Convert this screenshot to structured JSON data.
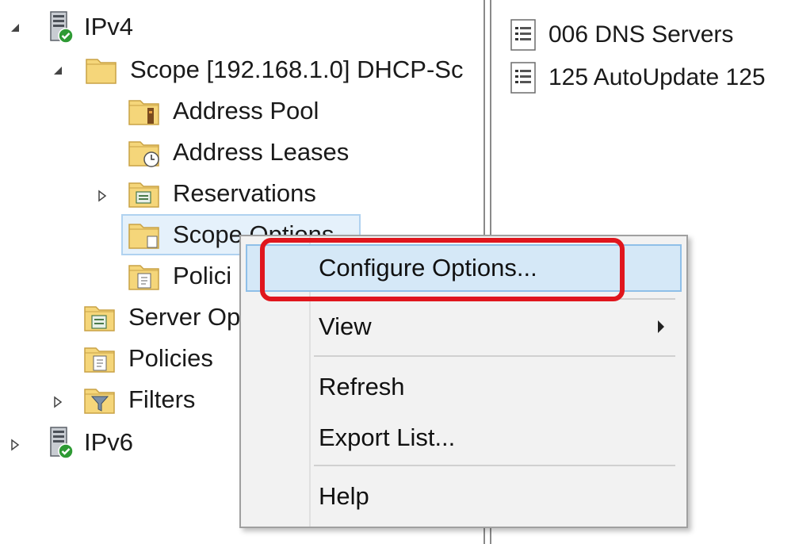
{
  "tree": {
    "ipv4": "IPv4",
    "scope": "Scope [192.168.1.0] DHCP-Sc",
    "address_pool": "Address Pool",
    "address_leases": "Address Leases",
    "reservations": "Reservations",
    "scope_options": "Scope Options",
    "scope_policies": "Polici",
    "server_options": "Server Op",
    "policies": "Policies",
    "filters": "Filters",
    "ipv6": "IPv6"
  },
  "list": {
    "items": [
      "006 DNS Servers",
      "125 AutoUpdate 125"
    ]
  },
  "context_menu": {
    "configure_options": "Configure Options...",
    "view": "View",
    "refresh": "Refresh",
    "export_list": "Export List...",
    "help": "Help"
  },
  "colors": {
    "highlight": "#e0161d",
    "selection": "#e5f1fb",
    "folder": "#f5d67a"
  },
  "icons": {
    "server": "server-icon",
    "folder": "folder-icon",
    "document": "document-icon"
  }
}
